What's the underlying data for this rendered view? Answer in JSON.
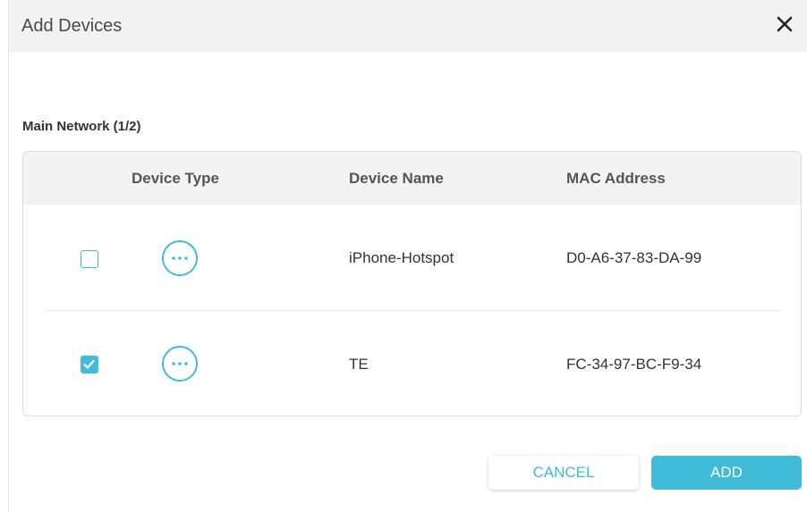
{
  "dialog": {
    "title": "Add Devices",
    "close_icon": "close-icon"
  },
  "section": {
    "title": "Main Network (1/2)"
  },
  "table": {
    "columns": [
      "Device Type",
      "Device Name",
      "MAC Address"
    ],
    "rows": [
      {
        "checked": false,
        "device_type_icon": "more-dots-icon",
        "device_name": "iPhone-Hotspot",
        "mac_address": "D0-A6-37-83-DA-99"
      },
      {
        "checked": true,
        "device_type_icon": "more-dots-icon",
        "device_name": "TE",
        "mac_address": "FC-34-97-BC-F9-34"
      }
    ]
  },
  "actions": {
    "cancel_label": "CANCEL",
    "add_label": "ADD"
  },
  "colors": {
    "accent": "#40bcd8",
    "header_bg": "#f2f2f2",
    "text": "#333333"
  }
}
